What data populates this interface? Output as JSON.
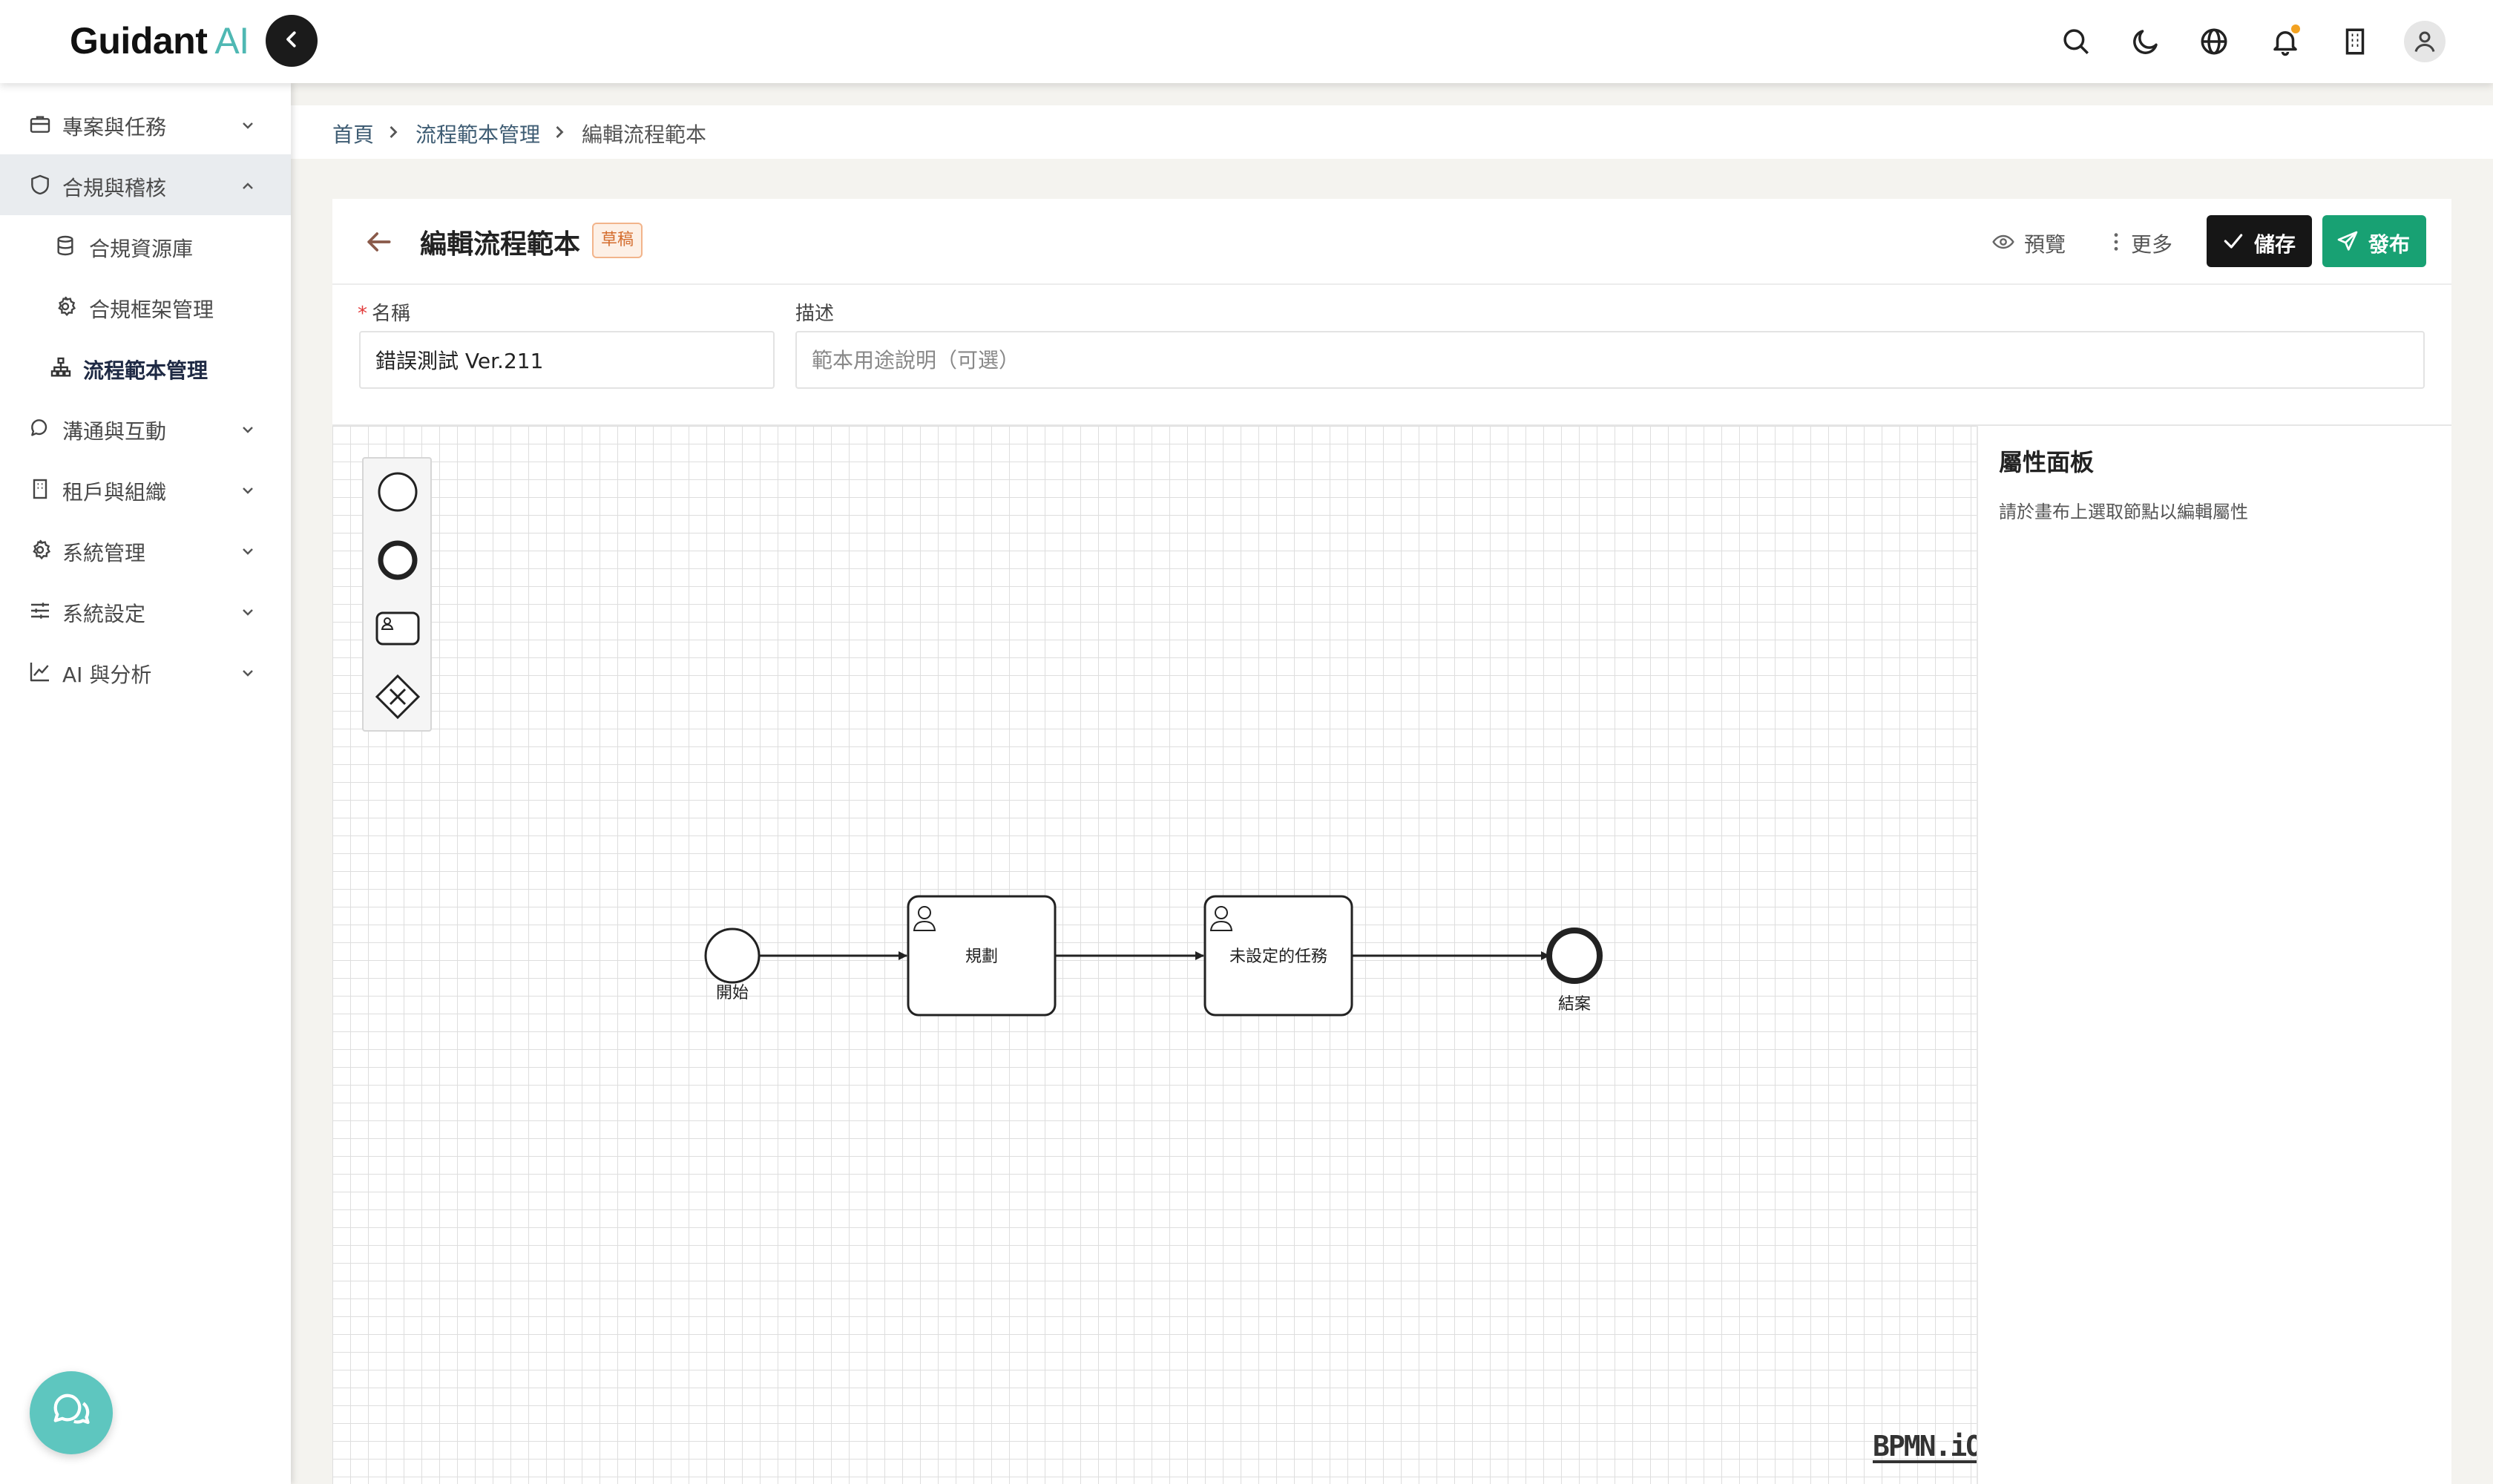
{
  "app": {
    "logo_main": "Guidant",
    "logo_accent": "AI"
  },
  "topbar": {
    "icons": [
      "search-icon",
      "moon-icon",
      "globe-icon",
      "bell-icon",
      "building-icon",
      "user-icon"
    ]
  },
  "sidebar": {
    "items": [
      {
        "label": "專案與任務",
        "icon": "briefcase-icon",
        "expanded": false
      },
      {
        "label": "合規與稽核",
        "icon": "shield-icon",
        "expanded": true,
        "active": true
      },
      {
        "label": "合規資源庫",
        "icon": "database-icon",
        "sub": true
      },
      {
        "label": "合規框架管理",
        "icon": "gear-icon",
        "sub": true
      },
      {
        "label": "流程範本管理",
        "icon": "sitemap-icon",
        "sub": true,
        "current": true
      },
      {
        "label": "溝通與互動",
        "icon": "chat-icon",
        "expanded": false
      },
      {
        "label": "租戶與組織",
        "icon": "building-icon",
        "expanded": false
      },
      {
        "label": "系統管理",
        "icon": "gear-icon",
        "expanded": false
      },
      {
        "label": "系統設定",
        "icon": "sliders-icon",
        "expanded": false
      },
      {
        "label": "AI 與分析",
        "icon": "chart-icon",
        "expanded": false
      }
    ]
  },
  "breadcrumb": {
    "home": "首頁",
    "parent": "流程範本管理",
    "current": "編輯流程範本"
  },
  "page": {
    "title": "編輯流程範本",
    "badge": "草稿",
    "preview_label": "預覽",
    "more_label": "更多",
    "save_label": "儲存",
    "publish_label": "發布"
  },
  "form": {
    "name_label": "名稱",
    "name_value": "錯誤測試 Ver.211",
    "desc_label": "描述",
    "desc_placeholder": "範本用途說明（可選）"
  },
  "diagram": {
    "start_label": "開始",
    "task1_label": "規劃",
    "task2_label": "未設定的任務",
    "end_label": "結案",
    "watermark": "BPMN.iO"
  },
  "props": {
    "title": "屬性面板",
    "hint": "請於畫布上選取節點以編輯屬性"
  },
  "colors": {
    "accent_teal": "#4fb8b3",
    "publish_green": "#18a173",
    "save_black": "#161616",
    "draft_orange": "#d46d2e",
    "notification_dot": "#f3a221"
  }
}
